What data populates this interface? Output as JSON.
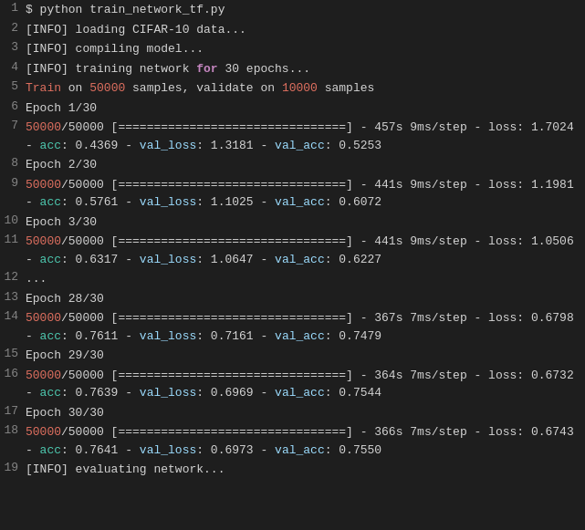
{
  "terminal": {
    "background": "#1e1e1e",
    "lines": [
      {
        "num": "1",
        "parts": [
          {
            "text": "$ python train_network_tf.py",
            "class": ""
          }
        ]
      },
      {
        "num": "2",
        "parts": [
          {
            "text": "[INFO] loading CIFAR-10 data...",
            "class": ""
          }
        ]
      },
      {
        "num": "3",
        "parts": [
          {
            "text": "[INFO] compiling model...",
            "class": ""
          }
        ]
      },
      {
        "num": "4",
        "parts": [
          {
            "text": "[INFO] training network ",
            "class": ""
          },
          {
            "text": "for",
            "class": "keyword-for"
          },
          {
            "text": " 30 epochs...",
            "class": ""
          }
        ]
      },
      {
        "num": "5",
        "parts": [
          {
            "text": "Train",
            "class": "highlight-orange"
          },
          {
            "text": " on ",
            "class": ""
          },
          {
            "text": "50000",
            "class": "highlight-orange"
          },
          {
            "text": " samples, validate on ",
            "class": ""
          },
          {
            "text": "10000",
            "class": "highlight-orange"
          },
          {
            "text": " samples",
            "class": ""
          }
        ]
      },
      {
        "num": "6",
        "parts": [
          {
            "text": "Epoch 1/30",
            "class": ""
          }
        ]
      },
      {
        "num": "7",
        "parts": [
          {
            "text": "50000",
            "class": "highlight-orange"
          },
          {
            "text": "/50000 [================================] - 457s 9ms/step - loss: 1.7024 - ",
            "class": ""
          },
          {
            "text": "acc",
            "class": "highlight-acc"
          },
          {
            "text": ": 0.4369 - ",
            "class": ""
          },
          {
            "text": "val_loss",
            "class": "highlight-val"
          },
          {
            "text": ": 1.3181 - ",
            "class": ""
          },
          {
            "text": "val_acc",
            "class": "highlight-val-acc"
          },
          {
            "text": ": 0.5253",
            "class": ""
          }
        ]
      },
      {
        "num": "8",
        "parts": [
          {
            "text": "Epoch 2/30",
            "class": ""
          }
        ]
      },
      {
        "num": "9",
        "parts": [
          {
            "text": "50000",
            "class": "highlight-orange"
          },
          {
            "text": "/50000 [================================] - 441s 9ms/step - loss: 1.1981 - ",
            "class": ""
          },
          {
            "text": "acc",
            "class": "highlight-acc"
          },
          {
            "text": ": 0.5761 - ",
            "class": ""
          },
          {
            "text": "val_loss",
            "class": "highlight-val"
          },
          {
            "text": ": 1.1025 - ",
            "class": ""
          },
          {
            "text": "val_acc",
            "class": "highlight-val-acc"
          },
          {
            "text": ": 0.6072",
            "class": ""
          }
        ]
      },
      {
        "num": "10",
        "parts": [
          {
            "text": "Epoch 3/30",
            "class": ""
          }
        ]
      },
      {
        "num": "11",
        "parts": [
          {
            "text": "50000",
            "class": "highlight-orange"
          },
          {
            "text": "/50000 [================================] - 441s 9ms/step - loss: 1.0506 - ",
            "class": ""
          },
          {
            "text": "acc",
            "class": "highlight-acc"
          },
          {
            "text": ": 0.6317 - ",
            "class": ""
          },
          {
            "text": "val_loss",
            "class": "highlight-val"
          },
          {
            "text": ": 1.0647 - ",
            "class": ""
          },
          {
            "text": "val_acc",
            "class": "highlight-val-acc"
          },
          {
            "text": ": 0.6227",
            "class": ""
          }
        ]
      },
      {
        "num": "12",
        "parts": [
          {
            "text": "...",
            "class": ""
          }
        ]
      },
      {
        "num": "13",
        "parts": [
          {
            "text": "Epoch 28/30",
            "class": ""
          }
        ]
      },
      {
        "num": "14",
        "parts": [
          {
            "text": "50000",
            "class": "highlight-orange"
          },
          {
            "text": "/50000 [================================] - 367s 7ms/step - loss: 0.6798 - ",
            "class": ""
          },
          {
            "text": "acc",
            "class": "highlight-acc"
          },
          {
            "text": ": 0.7611 - ",
            "class": ""
          },
          {
            "text": "val_loss",
            "class": "highlight-val"
          },
          {
            "text": ": 0.7161 - ",
            "class": ""
          },
          {
            "text": "val_acc",
            "class": "highlight-val-acc"
          },
          {
            "text": ": 0.7479",
            "class": ""
          }
        ]
      },
      {
        "num": "15",
        "parts": [
          {
            "text": "Epoch 29/30",
            "class": ""
          }
        ]
      },
      {
        "num": "16",
        "parts": [
          {
            "text": "50000",
            "class": "highlight-orange"
          },
          {
            "text": "/50000 [================================] - 364s 7ms/step - loss: 0.6732 - ",
            "class": ""
          },
          {
            "text": "acc",
            "class": "highlight-acc"
          },
          {
            "text": ": 0.7639 - ",
            "class": ""
          },
          {
            "text": "val_loss",
            "class": "highlight-val"
          },
          {
            "text": ": 0.6969 - ",
            "class": ""
          },
          {
            "text": "val_acc",
            "class": "highlight-val-acc"
          },
          {
            "text": ": 0.7544",
            "class": ""
          }
        ]
      },
      {
        "num": "17",
        "parts": [
          {
            "text": "Epoch 30/30",
            "class": ""
          }
        ]
      },
      {
        "num": "18",
        "parts": [
          {
            "text": "50000",
            "class": "highlight-orange"
          },
          {
            "text": "/50000 [================================] - 366s 7ms/step - loss: 0.6743 - ",
            "class": ""
          },
          {
            "text": "acc",
            "class": "highlight-acc"
          },
          {
            "text": ": 0.7641 - ",
            "class": ""
          },
          {
            "text": "val_loss",
            "class": "highlight-val"
          },
          {
            "text": ": 0.6973 - ",
            "class": ""
          },
          {
            "text": "val_acc",
            "class": "highlight-val-acc"
          },
          {
            "text": ": 0.7550",
            "class": ""
          }
        ]
      },
      {
        "num": "19",
        "parts": [
          {
            "text": "[INFO] evaluating network...",
            "class": ""
          }
        ]
      }
    ]
  }
}
